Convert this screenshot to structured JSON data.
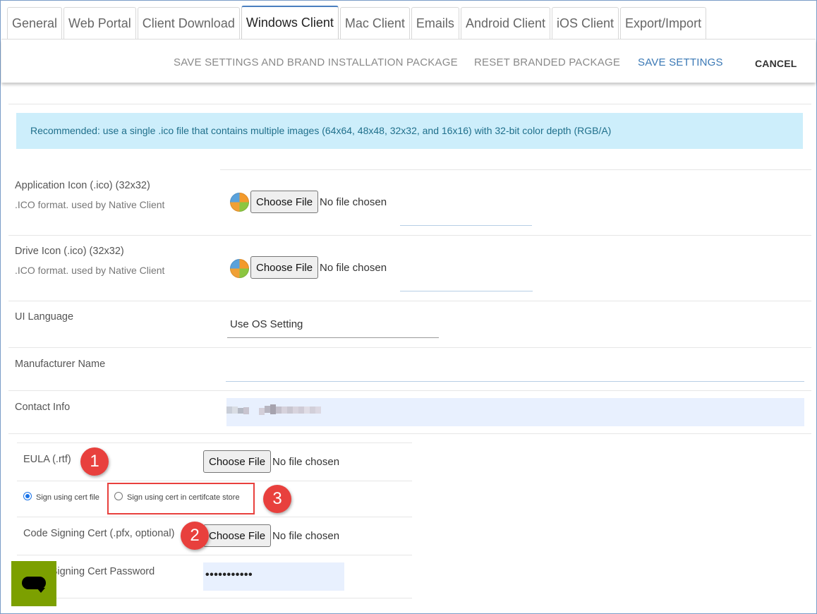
{
  "tabs": [
    {
      "label": "General"
    },
    {
      "label": "Web Portal"
    },
    {
      "label": "Client Download"
    },
    {
      "label": "Windows Client",
      "active": true
    },
    {
      "label": "Mac Client"
    },
    {
      "label": "Emails"
    },
    {
      "label": "Android Client"
    },
    {
      "label": "iOS Client"
    },
    {
      "label": "Export/Import"
    }
  ],
  "toolbar": {
    "save_brand": "SAVE SETTINGS AND BRAND INSTALLATION PACKAGE",
    "reset_branded": "RESET BRANDED PACKAGE",
    "save": "SAVE SETTINGS",
    "cancel": "CANCEL"
  },
  "info_banner": "Recommended: use a single .ico file that contains multiple images (64x64, 48x48, 32x32, and 16x16) with 32-bit color depth (RGB/A)",
  "form": {
    "app_icon": {
      "label": "Application Icon (.ico) (32x32)",
      "sublabel": ".ICO format. used by Native Client",
      "button": "Choose File",
      "status": "No file chosen"
    },
    "drive_icon": {
      "label": "Drive Icon (.ico) (32x32)",
      "sublabel": ".ICO format. used by Native Client",
      "button": "Choose File",
      "status": "No file chosen"
    },
    "ui_language": {
      "label": "UI Language",
      "value": "Use OS Setting"
    },
    "manufacturer": {
      "label": "Manufacturer Name",
      "value": ""
    },
    "contact_info": {
      "label": "Contact Info",
      "value_blurred": true
    },
    "eula": {
      "label": "EULA (.rtf)",
      "button": "Choose File",
      "status": "No file chosen"
    },
    "signing": {
      "option_file": "Sign using cert file",
      "option_store": "Sign using cert in certifcate store",
      "selected": "option_file"
    },
    "code_signing_cert": {
      "label": "Code Signing Cert (.pfx, optional)",
      "button": "Choose File",
      "status": "No file chosen"
    },
    "cert_password": {
      "label": "Code Signing Cert Password",
      "value": "•••••••••••"
    }
  },
  "callouts": {
    "one": "1",
    "two": "2",
    "three": "3"
  },
  "colors": {
    "accent_blue": "#3a78b5",
    "callout_red": "#e8403d",
    "info_bg": "#cdeefb",
    "chat_green": "#7ca000"
  },
  "icons": {
    "chat_widget": "chat-bubble-icon",
    "file_icon": "ico-file-icon"
  }
}
